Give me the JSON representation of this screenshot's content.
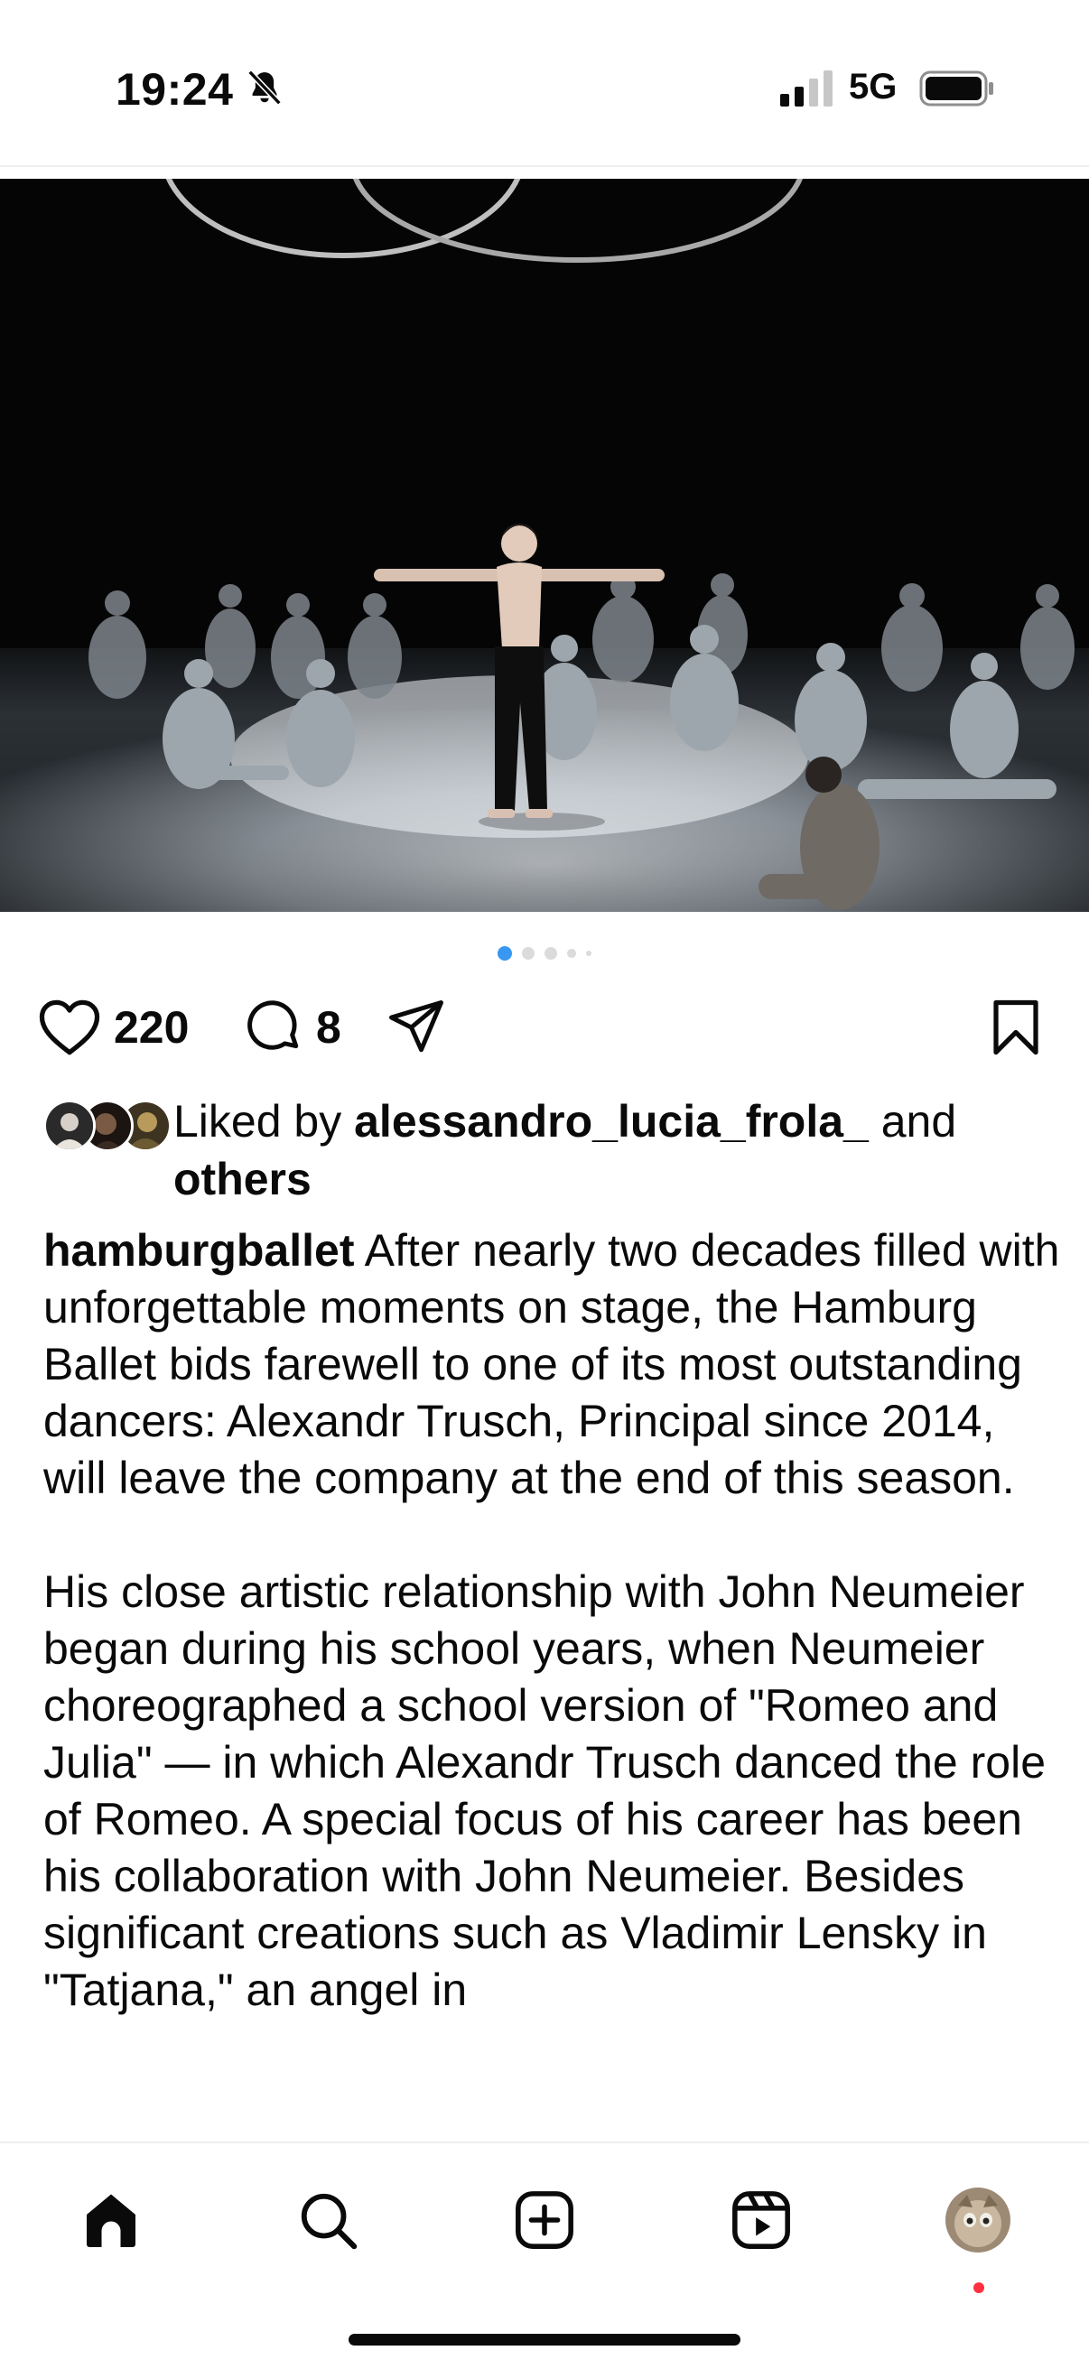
{
  "status_bar": {
    "time": "19:24",
    "network": "5G",
    "icons": [
      "bell-slash-icon",
      "signal-icon",
      "battery-icon"
    ]
  },
  "post": {
    "carousel": {
      "count": 5,
      "active_index": 0
    },
    "actions": {
      "likes": "220",
      "comments": "8",
      "icons": [
        "heart-icon",
        "comment-icon",
        "share-icon",
        "bookmark-icon"
      ]
    },
    "liked_by": {
      "prefix": "Liked by ",
      "user": "alessandro_lucia_frola_",
      "connector": " and",
      "others": "others"
    },
    "caption": {
      "username": "hamburgballet",
      "paragraph1": " After nearly two decades filled with unforgettable moments on stage, the Hamburg Ballet bids farewell to one of its most outstanding dancers: Alexandr Trusch, Principal since 2014, will leave the company at the end of this season.",
      "paragraph2": "His close artistic relationship with John Neumeier began during his school years, when Neumeier choreographed a school version of \"Romeo and Julia\" — in which Alexandr Trusch danced the role of Romeo. A special focus of his career has been his collaboration with John Neumeier. Besides significant creations such as Vladimir Lensky in \"Tatjana,\" an angel in"
    }
  },
  "bottom_nav": {
    "items": [
      "home-icon",
      "search-icon",
      "create-icon",
      "reels-icon",
      "profile-avatar"
    ],
    "active": "home"
  },
  "colors": {
    "text": "#0a0a0a",
    "dot_active": "#3897f0",
    "dot_inactive": "#dbdbdb",
    "notification": "#ff3040",
    "divider": "#efefef"
  }
}
